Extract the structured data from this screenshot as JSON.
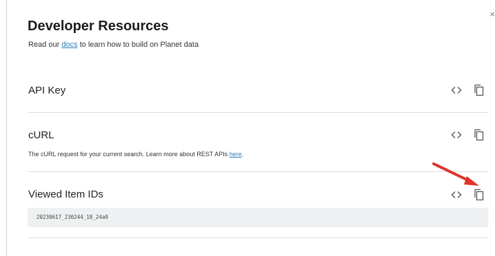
{
  "panel": {
    "title": "Developer Resources",
    "subtitle_prefix": "Read our ",
    "subtitle_link": "docs",
    "subtitle_suffix": " to learn how to build on Planet data",
    "close_glyph": "×"
  },
  "sections": {
    "api_key": {
      "label": "API Key"
    },
    "curl": {
      "label": "cURL",
      "desc_prefix": "The cURL request for your current search. Learn more about REST APIs ",
      "desc_link": "here",
      "desc_suffix": "."
    },
    "viewed_ids": {
      "label": "Viewed Item IDs",
      "value": "20230617_230244_18_24a9"
    }
  },
  "icons": {
    "code": "code-brackets-icon",
    "copy": "copy-icon",
    "close": "close-icon",
    "annotation": "red-arrow-icon"
  },
  "colors": {
    "link": "#2c7fb8",
    "annotation_arrow": "#e0332a",
    "id_box_bg": "#eef0f1"
  }
}
